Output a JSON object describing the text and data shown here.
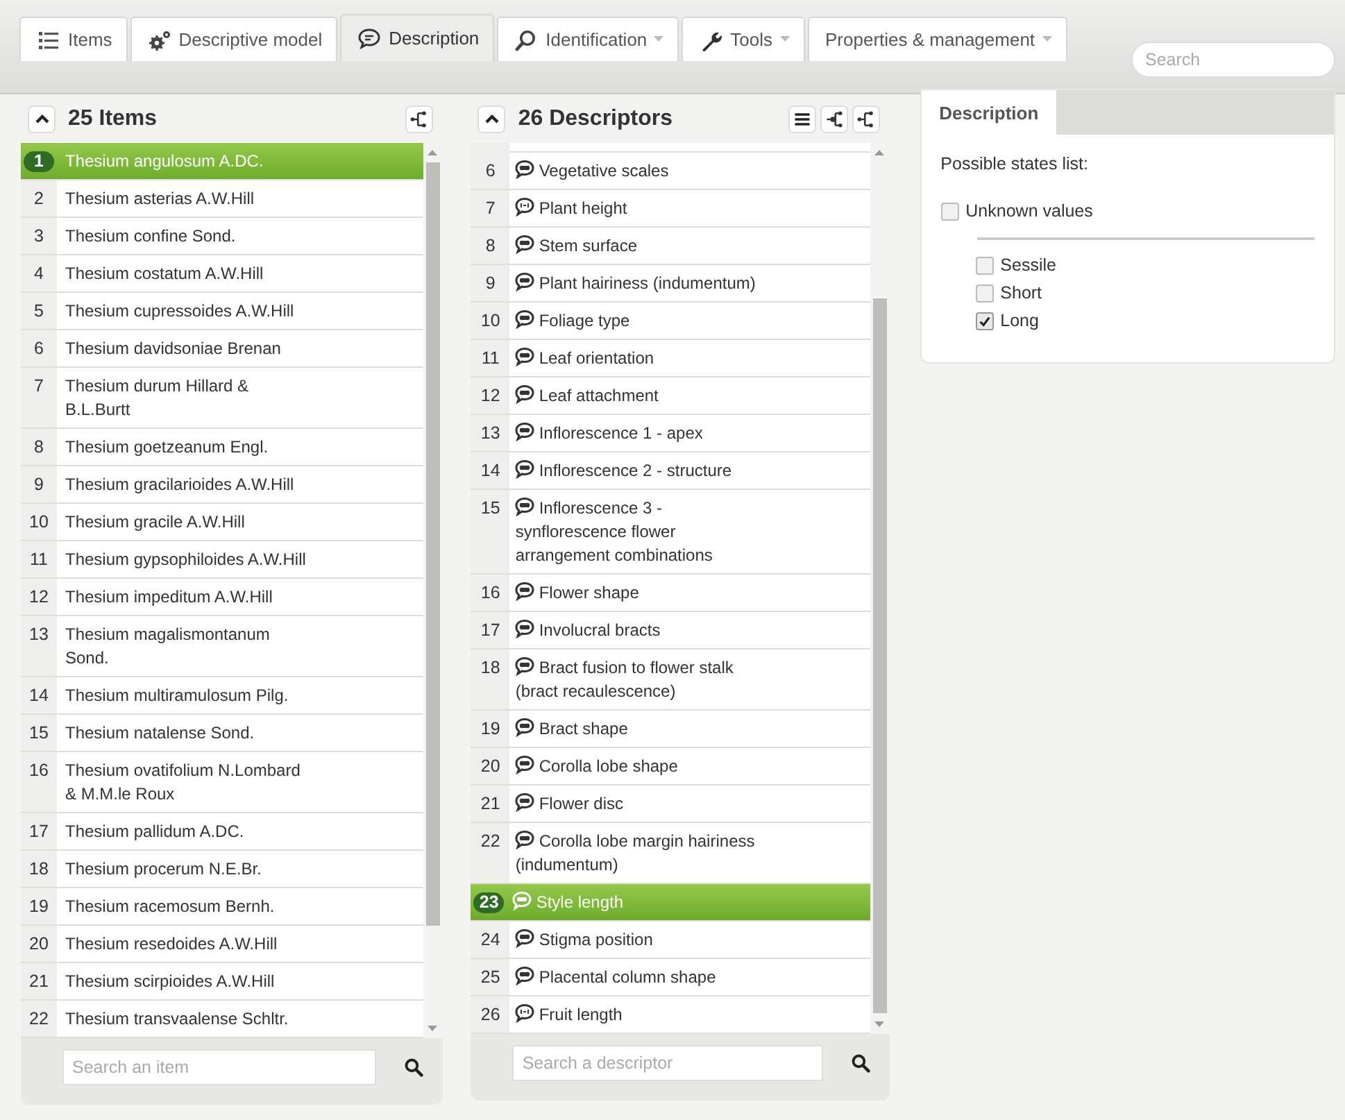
{
  "tabs": [
    {
      "label": "Items",
      "dropdown": false,
      "selected": false
    },
    {
      "label": "Descriptive model",
      "dropdown": false,
      "selected": false
    },
    {
      "label": "Description",
      "dropdown": false,
      "selected": true
    },
    {
      "label": "Identification",
      "dropdown": true,
      "selected": false
    },
    {
      "label": "Tools",
      "dropdown": true,
      "selected": false
    },
    {
      "label": "Properties & management",
      "dropdown": true,
      "selected": false
    }
  ],
  "search": {
    "placeholder": "Search"
  },
  "items_panel": {
    "title": "25 Items",
    "rows": [
      {
        "number": "1",
        "name": "Thesium angulosum A.DC.",
        "selected": true
      },
      {
        "number": "2",
        "name": "Thesium asterias A.W.Hill",
        "selected": false
      },
      {
        "number": "3",
        "name": "Thesium confine Sond.",
        "selected": false
      },
      {
        "number": "4",
        "name": "Thesium costatum A.W.Hill",
        "selected": false
      },
      {
        "number": "5",
        "name": "Thesium cupressoides A.W.Hill",
        "selected": false
      },
      {
        "number": "6",
        "name": "Thesium davidsoniae Brenan",
        "selected": false
      },
      {
        "number": "7",
        "name": "Thesium durum Hillard & B.L.Burtt",
        "selected": false
      },
      {
        "number": "8",
        "name": "Thesium goetzeanum Engl.",
        "selected": false
      },
      {
        "number": "9",
        "name": "Thesium gracilarioides A.W.Hill",
        "selected": false
      },
      {
        "number": "10",
        "name": "Thesium gracile A.W.Hill",
        "selected": false
      },
      {
        "number": "11",
        "name": "Thesium gypsophiloides A.W.Hill",
        "selected": false
      },
      {
        "number": "12",
        "name": "Thesium impeditum A.W.Hill",
        "selected": false
      },
      {
        "number": "13",
        "name": "Thesium magalismontanum Sond.",
        "selected": false
      },
      {
        "number": "14",
        "name": "Thesium multiramulosum Pilg.",
        "selected": false
      },
      {
        "number": "15",
        "name": "Thesium natalense Sond.",
        "selected": false
      },
      {
        "number": "16",
        "name": "Thesium ovatifolium N.Lombard & M.M.le Roux",
        "selected": false
      },
      {
        "number": "17",
        "name": "Thesium pallidum A.DC.",
        "selected": false
      },
      {
        "number": "18",
        "name": "Thesium procerum N.E.Br.",
        "selected": false
      },
      {
        "number": "19",
        "name": "Thesium racemosum Bernh.",
        "selected": false
      },
      {
        "number": "20",
        "name": "Thesium resedoides A.W.Hill",
        "selected": false
      },
      {
        "number": "21",
        "name": "Thesium scirpioides A.W.Hill",
        "selected": false
      },
      {
        "number": "22",
        "name": "Thesium transvaalense Schltr.",
        "selected": false
      }
    ],
    "search": {
      "placeholder": "Search an item"
    }
  },
  "descriptors_panel": {
    "title": "26 Descriptors",
    "rows": [
      {
        "number": "6",
        "name": "Vegetative scales",
        "kind": "qualitative",
        "selected": false
      },
      {
        "number": "7",
        "name": "Plant height",
        "kind": "quantitative",
        "selected": false
      },
      {
        "number": "8",
        "name": "Stem surface",
        "kind": "qualitative",
        "selected": false
      },
      {
        "number": "9",
        "name": "Plant hairiness (indumentum)",
        "kind": "qualitative",
        "selected": false
      },
      {
        "number": "10",
        "name": "Foliage type",
        "kind": "qualitative",
        "selected": false
      },
      {
        "number": "11",
        "name": "Leaf orientation",
        "kind": "qualitative",
        "selected": false
      },
      {
        "number": "12",
        "name": "Leaf attachment",
        "kind": "qualitative",
        "selected": false
      },
      {
        "number": "13",
        "name": "Inflorescence 1 - apex",
        "kind": "qualitative",
        "selected": false
      },
      {
        "number": "14",
        "name": "Inflorescence 2 - structure",
        "kind": "qualitative",
        "selected": false
      },
      {
        "number": "15",
        "name": "Inflorescence 3 - synflorescence flower arrangement combinations",
        "kind": "qualitative",
        "selected": false
      },
      {
        "number": "16",
        "name": "Flower shape",
        "kind": "qualitative",
        "selected": false
      },
      {
        "number": "17",
        "name": "Involucral bracts",
        "kind": "qualitative",
        "selected": false
      },
      {
        "number": "18",
        "name": "Bract fusion to flower stalk (bract recaulescence)",
        "kind": "qualitative",
        "selected": false
      },
      {
        "number": "19",
        "name": "Bract shape",
        "kind": "qualitative",
        "selected": false
      },
      {
        "number": "20",
        "name": "Corolla lobe shape",
        "kind": "qualitative",
        "selected": false
      },
      {
        "number": "21",
        "name": "Flower disc",
        "kind": "qualitative",
        "selected": false
      },
      {
        "number": "22",
        "name": "Corolla lobe margin hairiness (indumentum)",
        "kind": "qualitative",
        "selected": false
      },
      {
        "number": "23",
        "name": "Style length",
        "kind": "qualitative",
        "selected": true
      },
      {
        "number": "24",
        "name": "Stigma position",
        "kind": "qualitative",
        "selected": false
      },
      {
        "number": "25",
        "name": "Placental column shape",
        "kind": "qualitative",
        "selected": false
      },
      {
        "number": "26",
        "name": "Fruit length",
        "kind": "quantitative",
        "selected": false
      }
    ],
    "search": {
      "placeholder": "Search a descriptor"
    }
  },
  "description_panel": {
    "tab": "Description",
    "heading": "Possible states list:",
    "unknown": {
      "label": "Unknown values",
      "checked": false
    },
    "states": [
      {
        "label": "Sessile",
        "checked": false
      },
      {
        "label": "Short",
        "checked": false
      },
      {
        "label": "Long",
        "checked": true
      }
    ]
  }
}
